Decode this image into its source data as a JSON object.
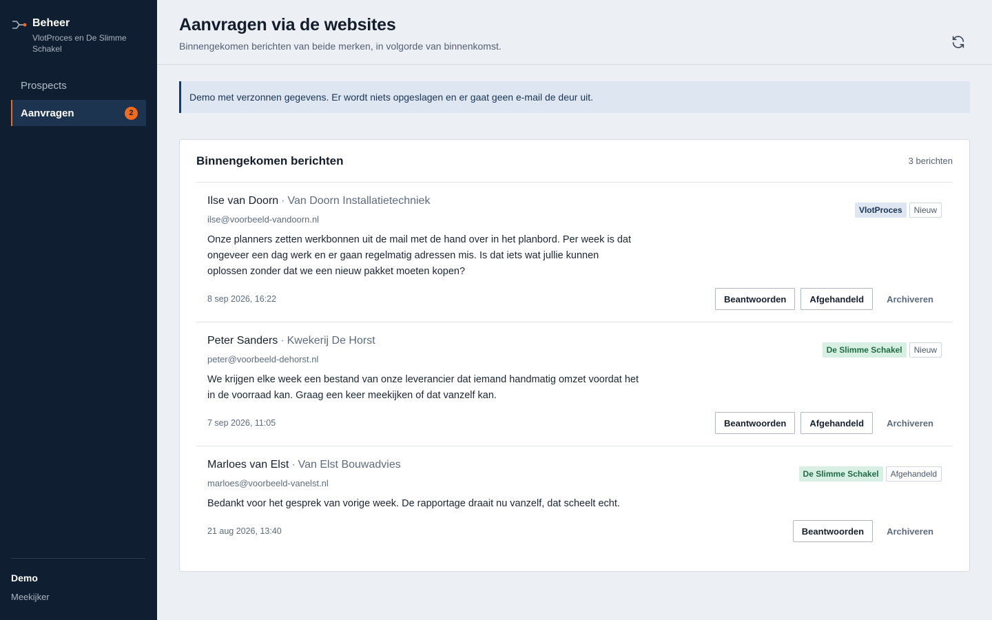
{
  "sidebar": {
    "brand_title": "Beheer",
    "brand_subtitle": "VlotProces en De Slimme Schakel",
    "nav": [
      {
        "label": "Prospects",
        "active": false
      },
      {
        "label": "Aanvragen",
        "active": true,
        "badge": "2"
      }
    ],
    "footer_title": "Demo",
    "footer_role": "Meekijker"
  },
  "header": {
    "title": "Aanvragen via de websites",
    "subtitle": "Binnengekomen berichten van beide merken, in volgorde van binnenkomst."
  },
  "notice": "Demo met verzonnen gegevens. Er wordt niets opgeslagen en er gaat geen e-mail de deur uit.",
  "inbox": {
    "title": "Binnengekomen berichten",
    "count": "3 berichten",
    "messages": [
      {
        "name": "Ilse van Doorn",
        "separator": "·",
        "company": "Van Doorn Installatietechniek",
        "email": "ilse@voorbeeld-vandoorn.nl",
        "brand": "VlotProces",
        "status": "Nieuw",
        "body": "Onze planners zetten werkbonnen uit de mail met de hand over in het planbord. Per week is dat ongeveer een dag werk en er gaan regelmatig adressen mis. Is dat iets wat jullie kunnen oplossen zonder dat we een nieuw pakket moeten kopen?",
        "date": "8 sep 2026, 16:22",
        "reply_label": "Beantwoorden",
        "done_label": "Afgehandeld",
        "archive_label": "Archiveren"
      },
      {
        "name": "Peter Sanders",
        "separator": "·",
        "company": "Kwekerij De Horst",
        "email": "peter@voorbeeld-dehorst.nl",
        "brand": "De Slimme Schakel",
        "status": "Nieuw",
        "body": "We krijgen elke week een bestand van onze leverancier dat iemand handmatig omzet voordat het in de voorraad kan. Graag een keer meekijken of dat vanzelf kan.",
        "date": "7 sep 2026, 11:05",
        "reply_label": "Beantwoorden",
        "done_label": "Afgehandeld",
        "archive_label": "Archiveren"
      },
      {
        "name": "Marloes van Elst",
        "separator": "·",
        "company": "Van Elst Bouwadvies",
        "email": "marloes@voorbeeld-vanelst.nl",
        "brand": "De Slimme Schakel",
        "status": "Afgehandeld",
        "body": "Bedankt voor het gesprek van vorige week. De rapportage draait nu vanzelf, dat scheelt echt.",
        "date": "21 aug 2026, 13:40",
        "reply_label": "Beantwoorden",
        "archive_label": "Archiveren"
      }
    ]
  },
  "colors": {
    "sidebar_bg": "#0f1e30",
    "accent": "#f06b1d",
    "vlotproces_tag": "#dde6f1",
    "slimme_schakel_tag": "#d8efe3"
  }
}
